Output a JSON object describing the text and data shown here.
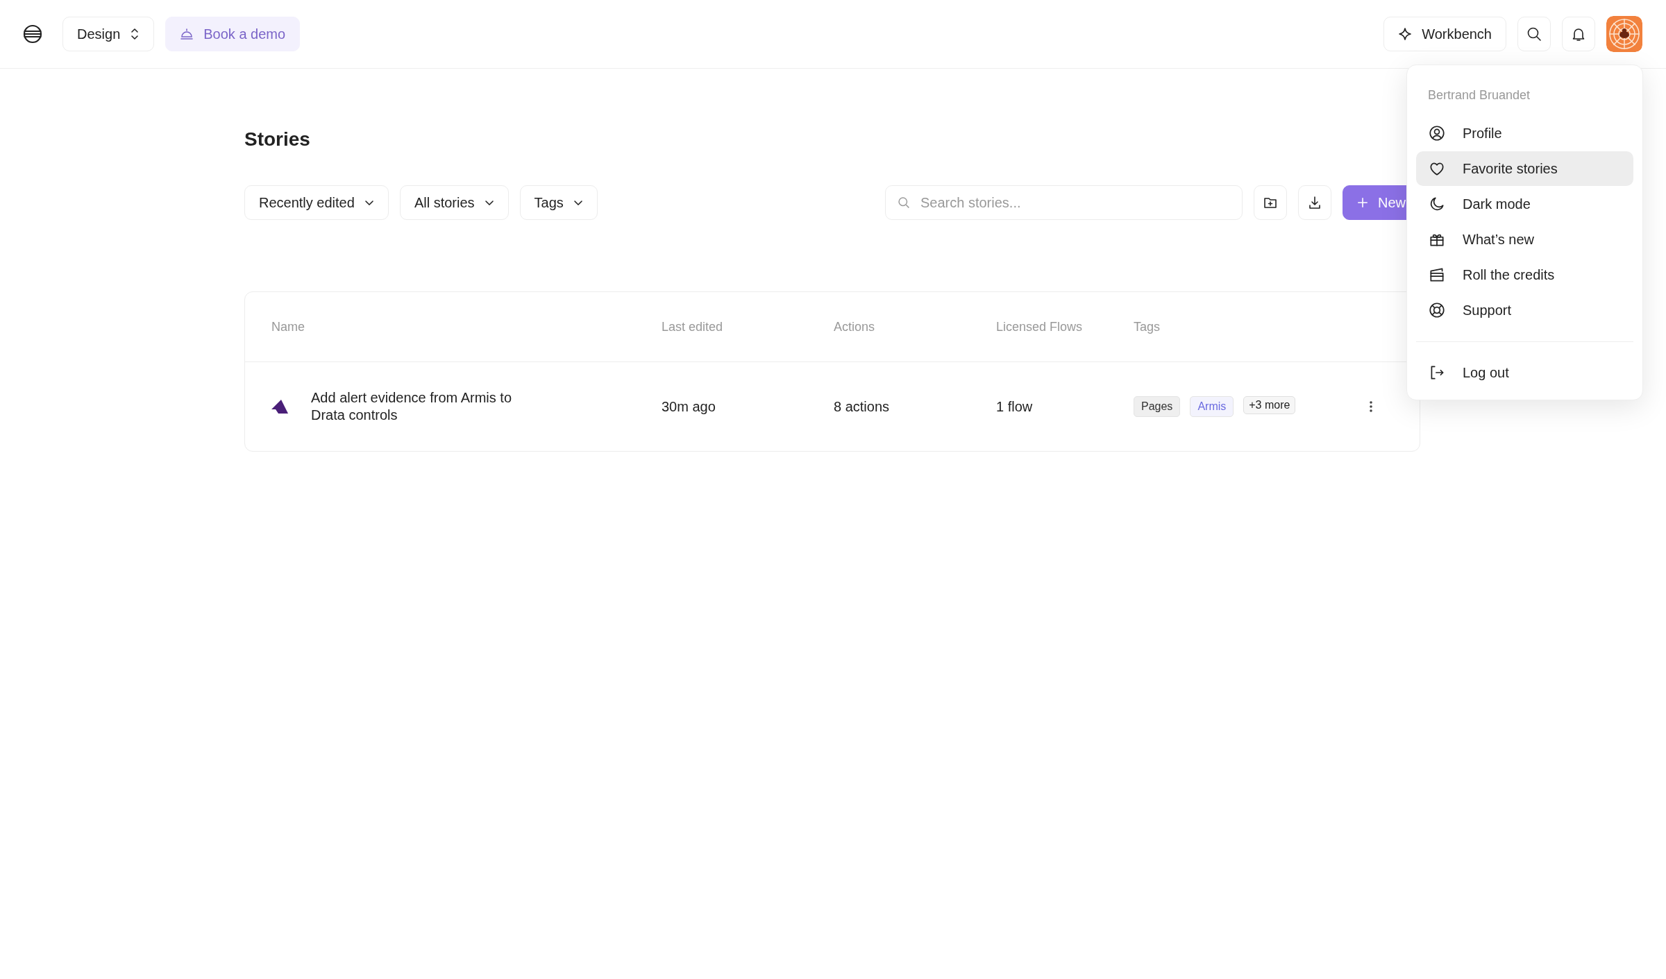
{
  "topbar": {
    "workspace": "Design",
    "demo_button": "Book a demo",
    "workbench_button": "Workbench"
  },
  "page": {
    "title": "Stories",
    "filters": [
      {
        "label": "Recently edited"
      },
      {
        "label": "All stories"
      },
      {
        "label": "Tags"
      }
    ],
    "search": {
      "placeholder": "Search stories..."
    },
    "new_button": "New"
  },
  "table": {
    "columns": [
      "Name",
      "Last edited",
      "Actions",
      "Licensed Flows",
      "Tags"
    ],
    "rows": [
      {
        "name": "Add alert evidence from Armis to Drata controls",
        "last_edited": "30m ago",
        "actions": "8 actions",
        "licensed_flows": "1 flow",
        "tags": [
          {
            "label": "Pages",
            "color": "#333333"
          },
          {
            "label": "Armis",
            "color": "#6a6ae0"
          }
        ],
        "more_tags": "+3 more"
      }
    ]
  },
  "user_menu": {
    "user_name": "Bertrand Bruandet",
    "items": [
      {
        "label": "Profile",
        "selected": false
      },
      {
        "label": "Favorite stories",
        "selected": true
      },
      {
        "label": "Dark mode",
        "selected": false
      },
      {
        "label": "What’s new",
        "selected": false
      },
      {
        "label": "Roll the credits",
        "selected": false
      },
      {
        "label": "Support",
        "selected": false
      }
    ],
    "footer_items": [
      {
        "label": "Log out",
        "selected": false
      }
    ]
  }
}
